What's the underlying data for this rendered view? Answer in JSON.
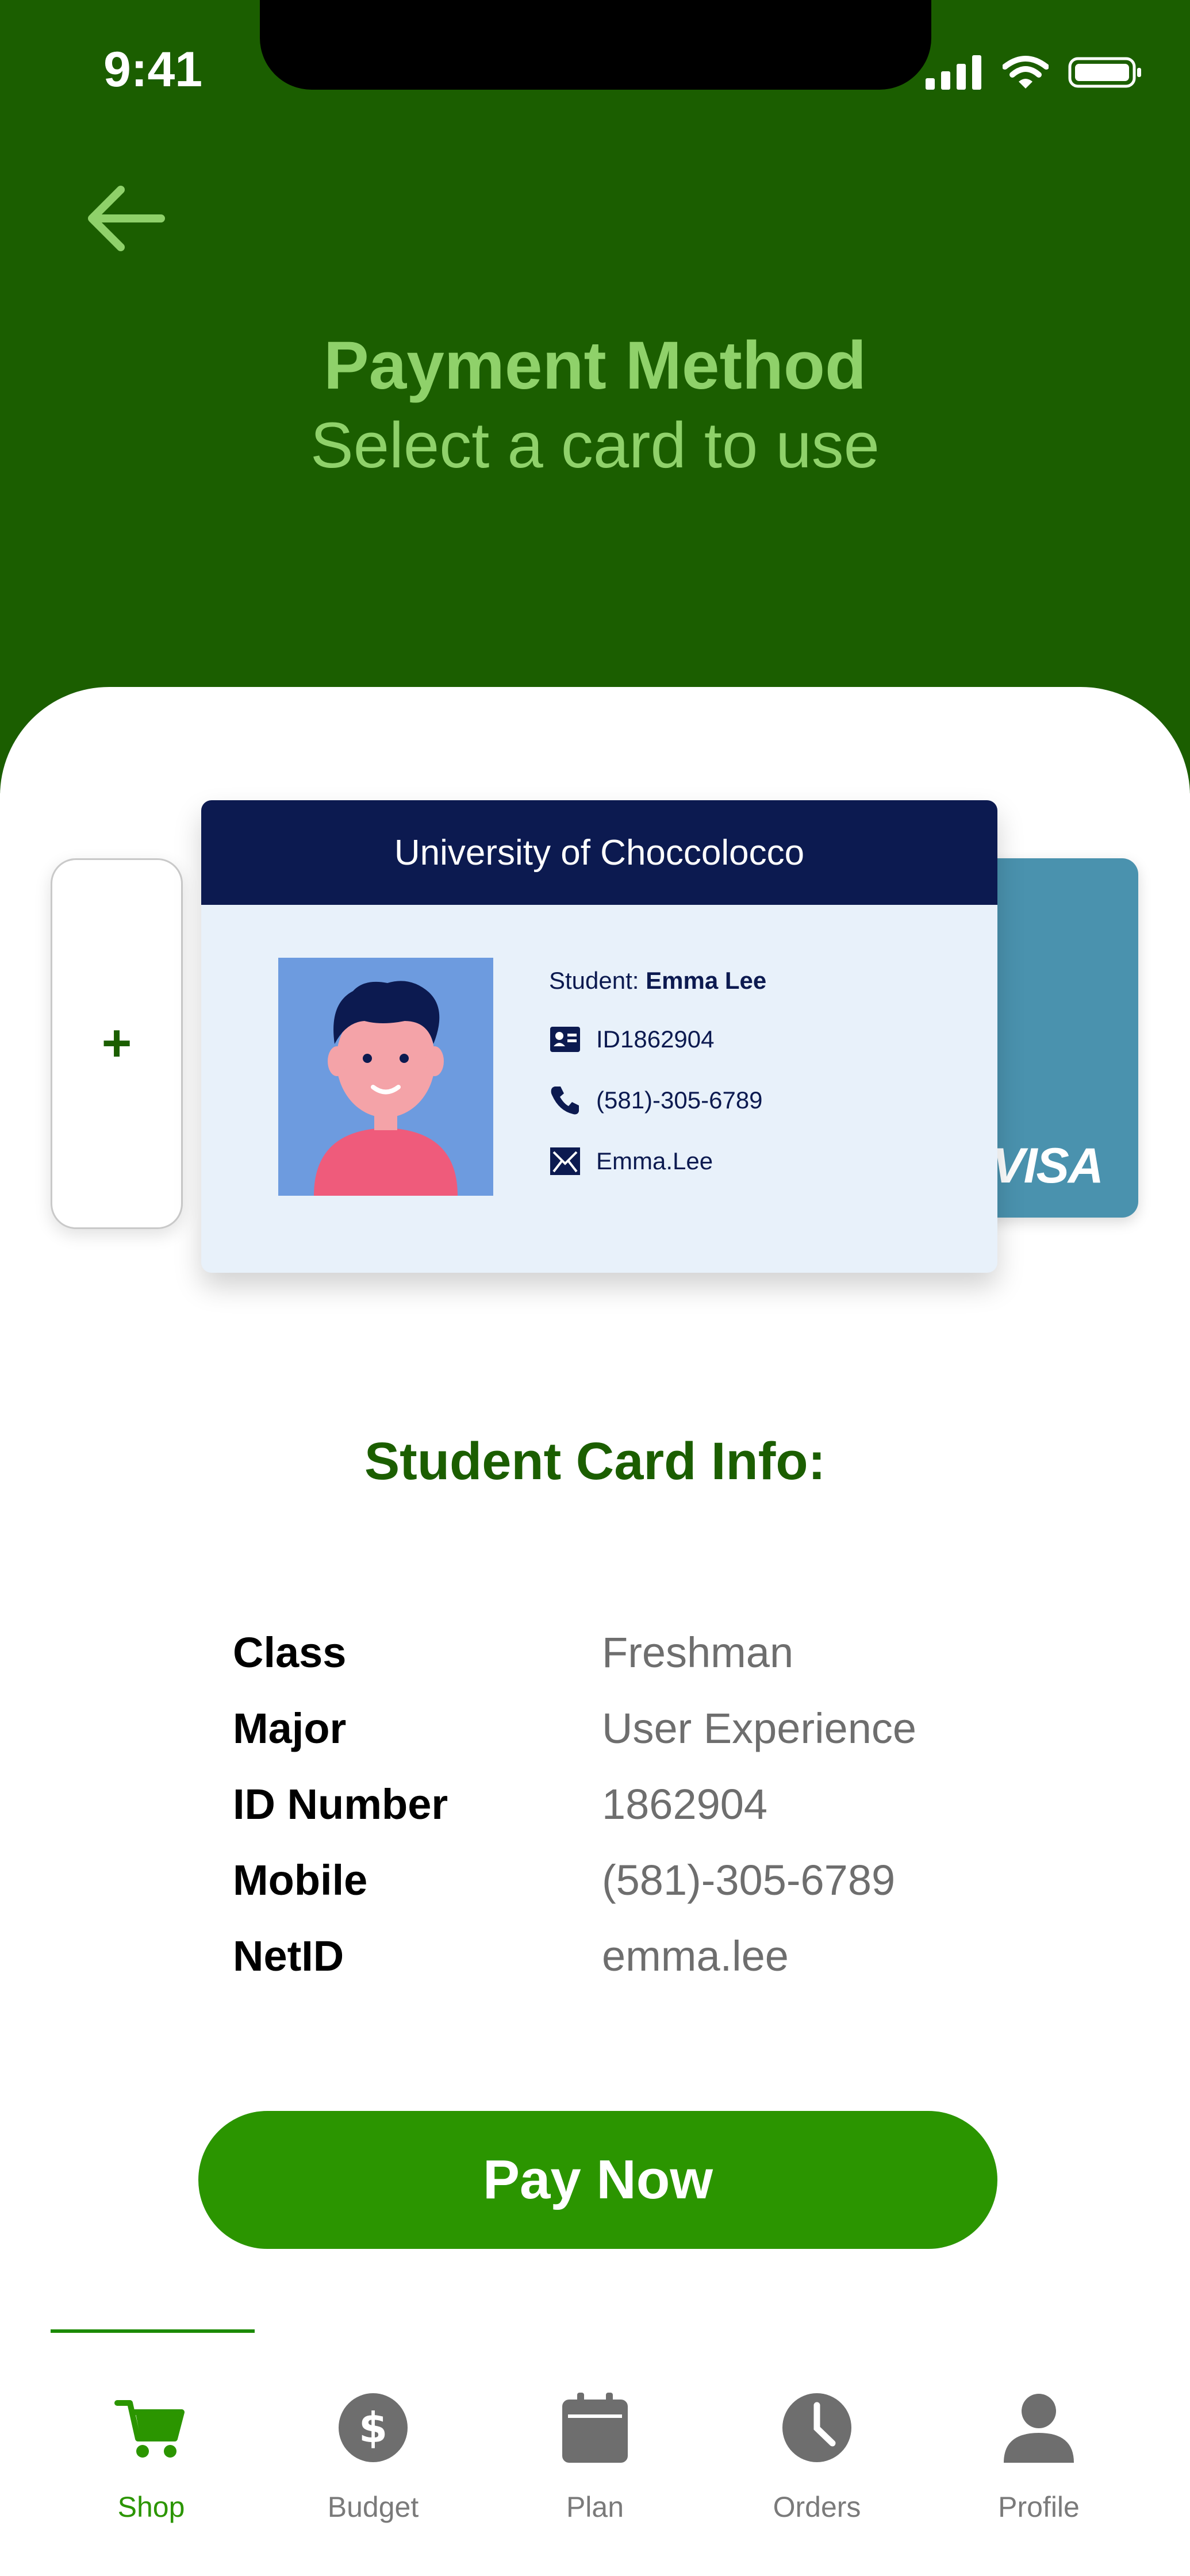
{
  "status_bar": {
    "time": "9:41"
  },
  "header": {
    "title": "Payment Method",
    "subtitle": "Select a card to use"
  },
  "cards": {
    "add_symbol": "+",
    "visa_label": "VISA",
    "student_card": {
      "university": "University of Choccolocco",
      "student_prefix": "Student:",
      "student_name": "Emma Lee",
      "id": "ID1862904",
      "phone": "(581)-305-6789",
      "email": "Emma.Lee"
    }
  },
  "info": {
    "title": "Student Card Info:",
    "rows": [
      {
        "label": "Class",
        "value": "Freshman"
      },
      {
        "label": "Major",
        "value": "User Experience"
      },
      {
        "label": "ID Number",
        "value": "1862904"
      },
      {
        "label": "Mobile",
        "value": "(581)-305-6789"
      },
      {
        "label": "NetID",
        "value": "emma.lee"
      }
    ]
  },
  "pay_button": {
    "label": "Pay Now"
  },
  "tabs": [
    {
      "label": "Shop",
      "icon": "cart-icon",
      "active": true
    },
    {
      "label": "Budget",
      "icon": "dollar-icon",
      "active": false
    },
    {
      "label": "Plan",
      "icon": "calendar-icon",
      "active": false
    },
    {
      "label": "Orders",
      "icon": "clock-icon",
      "active": false
    },
    {
      "label": "Profile",
      "icon": "person-icon",
      "active": false
    }
  ],
  "colors": {
    "header_bg": "#1b5e00",
    "header_text": "#8fd16a",
    "accent": "#2b9500",
    "card_header": "#0c1a50",
    "visa_card": "#4a92ae"
  }
}
